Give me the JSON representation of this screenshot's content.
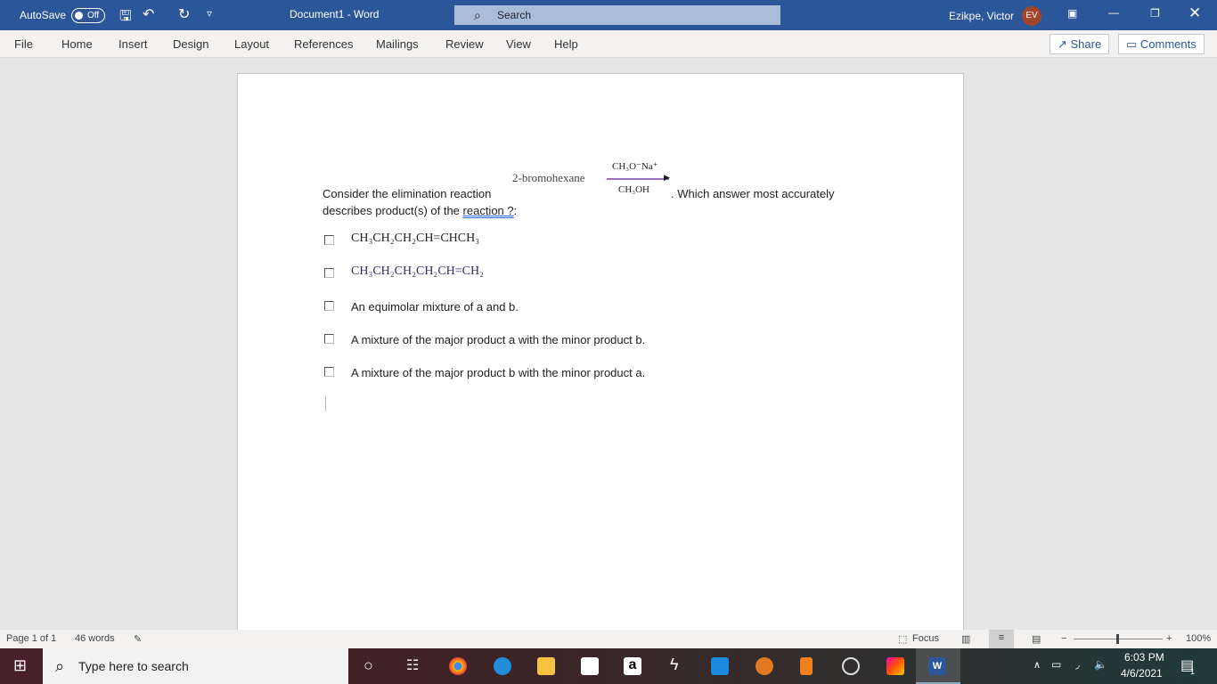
{
  "titlebar": {
    "autosave_label": "AutoSave",
    "autosave_state": "Off",
    "doc_title": "Document1  -  Word",
    "search_placeholder": "Search",
    "user_name": "Ezikpe, Victor",
    "user_initials": "EV"
  },
  "menu": {
    "tabs": [
      "File",
      "Home",
      "Insert",
      "Design",
      "Layout",
      "References",
      "Mailings",
      "Review",
      "View",
      "Help"
    ],
    "share": "Share",
    "comments": "Comments"
  },
  "document": {
    "question_start": "Consider the elimination reaction",
    "reactant": "2-bromohexane",
    "reagent_top": "CH₃O⁻Na⁺",
    "reagent_bottom": "CH₃OH",
    "question_mid": ".   Which answer most accurately",
    "question_line2_a": "describes product(s) of the ",
    "question_line2_link": "reaction ?",
    "question_line2_end": ":",
    "options": [
      "CH₃CH₂CH₂CH=CHCH₃",
      "CH₃CH₂CH₂CH₂CH=CH₂",
      "An equimolar mixture of a and b.",
      "A mixture of the major product a with the minor product b.",
      "A mixture of the major product b with the minor product a."
    ]
  },
  "statusbar": {
    "page": "Page 1 of 1",
    "words": "46 words",
    "focus": "Focus",
    "zoom": "100%",
    "zoom_percent": 100
  },
  "taskbar": {
    "search_placeholder": "Type here to search",
    "time": "6:03 PM",
    "date": "4/6/2021",
    "notifications": "1"
  },
  "colors": {
    "word_blue": "#2b579a",
    "arrow": "#9b6fbf"
  }
}
